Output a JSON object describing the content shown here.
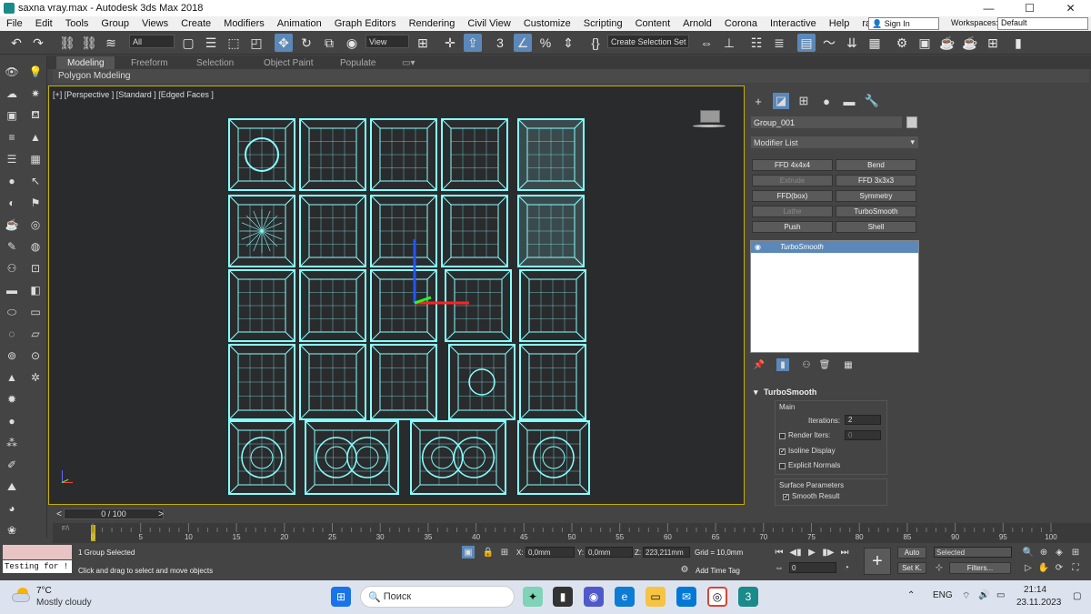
{
  "window": {
    "title": "saxna vray.max - Autodesk 3ds Max 2018",
    "min": "—",
    "max": "☐",
    "close": "✕"
  },
  "menu": [
    "File",
    "Edit",
    "Tools",
    "Group",
    "Views",
    "Create",
    "Modifiers",
    "Animation",
    "Graph Editors",
    "Rendering",
    "Civil View",
    "Customize",
    "Scripting",
    "Content",
    "Arnold",
    "Corona",
    "Interactive",
    "Help",
    "rapidTools"
  ],
  "account": {
    "signin": "Sign In",
    "workspaces_label": "Workspaces:",
    "workspace": "Default"
  },
  "toolbar": {
    "filter": "All",
    "refcoord": "View",
    "selset": "Create Selection Set"
  },
  "ribbon": {
    "tabs": [
      "Modeling",
      "Freeform",
      "Selection",
      "Object Paint",
      "Populate"
    ],
    "active": "Modeling",
    "sub": "Polygon Modeling"
  },
  "viewport": {
    "label": "[+] [Perspective ] [Standard ] [Edged Faces ]"
  },
  "panel": {
    "object_name": "Group_001",
    "modifier_list": "Modifier List",
    "buttons": [
      {
        "label": "FFD 4x4x4",
        "enabled": true
      },
      {
        "label": "Bend",
        "enabled": true
      },
      {
        "label": "Extrude",
        "enabled": false
      },
      {
        "label": "FFD 3x3x3",
        "enabled": true
      },
      {
        "label": "FFD(box)",
        "enabled": true
      },
      {
        "label": "Symmetry",
        "enabled": true
      },
      {
        "label": "Lathe",
        "enabled": false
      },
      {
        "label": "TurboSmooth",
        "enabled": true
      },
      {
        "label": "Push",
        "enabled": true
      },
      {
        "label": "Shell",
        "enabled": true
      }
    ],
    "stack_item": "TurboSmooth",
    "rollout": {
      "title": "TurboSmooth",
      "main": "Main",
      "iterations_label": "Iterations:",
      "iterations": "2",
      "render_iters_label": "Render Iters:",
      "render_iters": "0",
      "isoline": "Isoline Display",
      "isoline_checked": true,
      "explicit": "Explicit Normals",
      "explicit_checked": false,
      "surface": "Surface Parameters",
      "smooth": "Smooth Result",
      "smooth_checked": true
    }
  },
  "timeline": {
    "frame": "0 / 100",
    "prev": "<",
    "next": ">",
    "ticks": [
      "0",
      "5",
      "10",
      "15",
      "20",
      "25",
      "30",
      "35",
      "40",
      "45",
      "50",
      "55",
      "60",
      "65",
      "70",
      "75",
      "80",
      "85",
      "90",
      "95",
      "100"
    ]
  },
  "status": {
    "maxscript": "Testing for !",
    "selected": "1 Group Selected",
    "prompt": "Click and drag to select and move objects",
    "x_label": "X:",
    "x": "0,0mm",
    "y_label": "Y:",
    "y": "0,0mm",
    "z_label": "Z:",
    "z": "223,211mm",
    "grid": "Grid = 10,0mm",
    "add_time_tag": "Add Time Tag",
    "auto": "Auto",
    "setk": "Set K.",
    "key_filter": "Selected",
    "filters": "Filters...",
    "frame_field": "0"
  },
  "taskbar": {
    "temp": "7°C",
    "weather": "Mostly cloudy",
    "search": "Поиск",
    "lang": "ENG",
    "time": "21:14",
    "date": "23.11.2023"
  },
  "colors": {
    "accent": "#5b88b8",
    "wire": "#88ffff",
    "viewport_bg": "#2a2b2d",
    "active_border": "#c7b000"
  }
}
